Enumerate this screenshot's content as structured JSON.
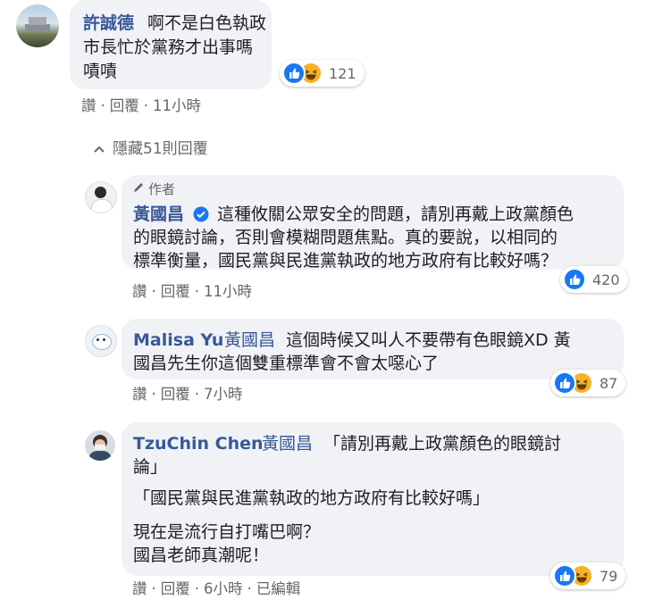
{
  "comments": [
    {
      "author": "許誠德",
      "lines": [
        "啊不是白色執政",
        "市長忙於黨務才出事嗎",
        "嘖嘖"
      ],
      "reactions_count": "121",
      "actions": {
        "like": "讚",
        "reply": "回覆",
        "time": "11小時"
      }
    }
  ],
  "hide_replies": {
    "label": "隱藏51則回覆"
  },
  "replies": [
    {
      "author_badge": "作者",
      "author": "黃國昌",
      "verified": true,
      "lines": [
        "這種攸關公眾安全的問題，請別再戴上政黨顏色",
        "的眼鏡討論，否則會模糊問題焦點。真的要說，以相同的",
        "標準衡量，國民黨與民進黨執政的地方政府有比較好嗎？"
      ],
      "reactions_count": "420",
      "actions": {
        "like": "讚",
        "reply": "回覆",
        "time": "11小時"
      }
    },
    {
      "author": "Malisa Yu",
      "mention": "黃國昌",
      "lines": [
        "這個時候又叫人不要帶有色眼鏡XD 黃",
        "國昌先生你這個雙重標準會不會太噁心了"
      ],
      "reactions_count": "87",
      "actions": {
        "like": "讚",
        "reply": "回覆",
        "time": "7小時"
      }
    },
    {
      "author": "TzuChin Chen",
      "mention": "黃國昌",
      "lines": [
        "「請別再戴上政黨顏色的眼鏡討",
        "論」",
        "「國民黨與民進黨執政的地方政府有比較好嗎」",
        "現在是流行自打嘴巴啊？",
        "國昌老師真潮呢！"
      ],
      "reactions_count": "79",
      "actions": {
        "like": "讚",
        "reply": "回覆",
        "time": "6小時",
        "edited": "已編輯"
      }
    }
  ],
  "colors": {
    "link": "#385898",
    "bubble": "#f0f2f5",
    "like": "#1877f2",
    "haha": "#f7b125",
    "meta": "#65676b"
  },
  "icons": [
    "like-icon",
    "haha-icon",
    "pencil-icon",
    "verified-icon",
    "chevron-up-icon"
  ]
}
